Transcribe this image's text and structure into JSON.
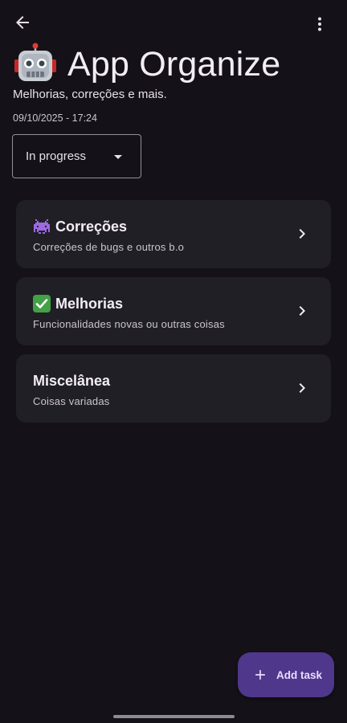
{
  "topbar": {
    "back_icon": "arrow-back-icon",
    "more_icon": "more-vert-icon"
  },
  "header": {
    "emoji_icon": "robot-emoji-icon",
    "title": "App Organize",
    "subtitle": "Melhorias, correções e mais.",
    "timestamp": "09/10/2025 - 17:24"
  },
  "status_dropdown": {
    "selected": "In progress",
    "caret_icon": "dropdown-caret-icon"
  },
  "categories": [
    {
      "emoji_icon": "alien-monster-emoji-icon",
      "title": "Correções",
      "subtitle": "Correções de bugs e outros b.o"
    },
    {
      "emoji_icon": "check-mark-emoji-icon",
      "title": "Melhorias",
      "subtitle": "Funcionalidades novas ou outras coisas"
    },
    {
      "emoji_icon": "",
      "title": "Miscelânea",
      "subtitle": "Coisas variadas"
    }
  ],
  "fab": {
    "icon": "plus-icon",
    "label": "Add task"
  },
  "colors": {
    "background": "#141218",
    "card": "#211F26",
    "fab": "#4F378B",
    "on_fab": "#EADDFF",
    "text": "#E6E0E9",
    "outline": "#938F99"
  }
}
